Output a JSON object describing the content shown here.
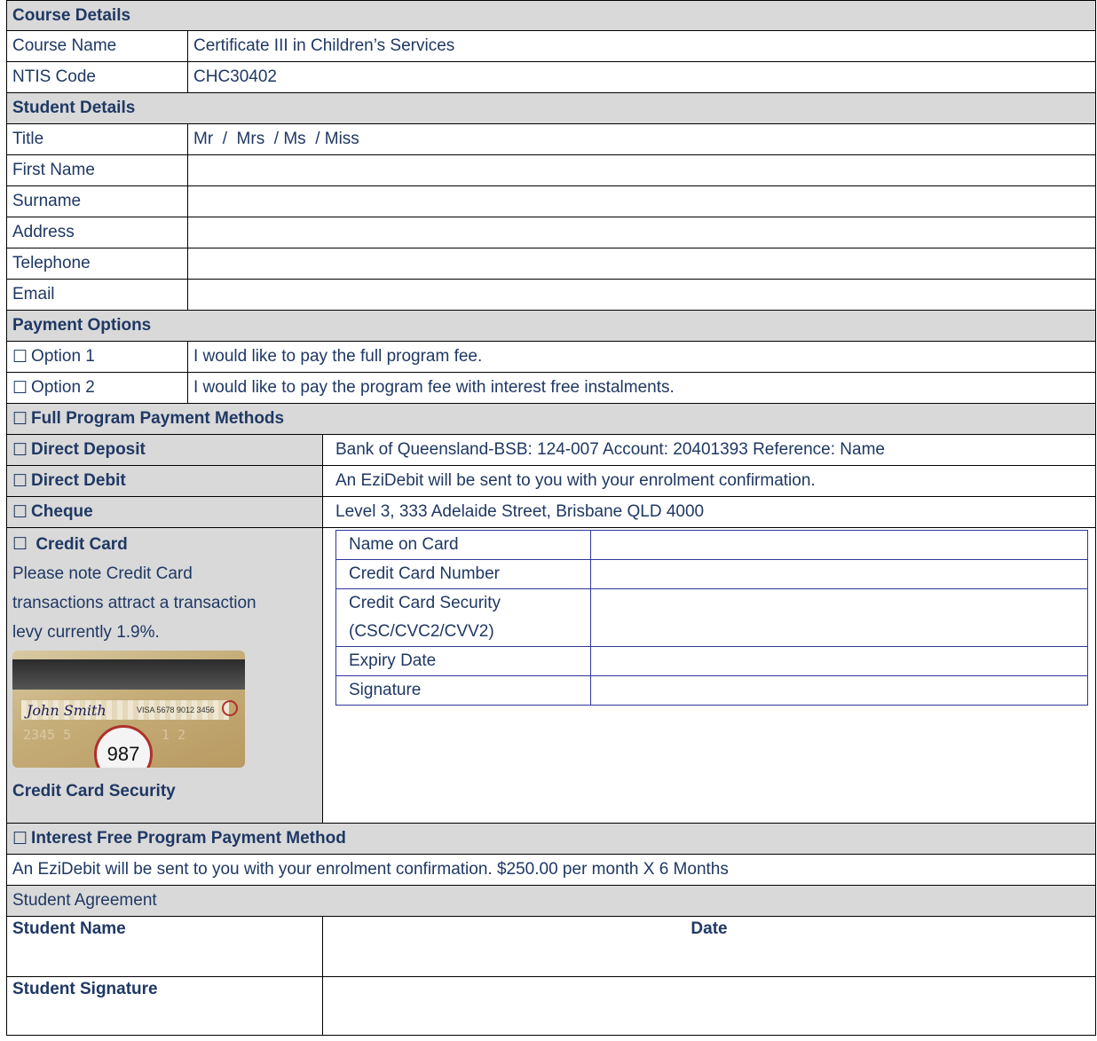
{
  "course": {
    "header": "Course Details",
    "rows": [
      {
        "label": "Course Name",
        "value": "Certificate III in Children’s Services"
      },
      {
        "label": "NTIS Code",
        "value": "CHC30402"
      }
    ]
  },
  "student": {
    "header": "Student Details",
    "rows": [
      {
        "label": "Title",
        "value": "Mr  /  Mrs  / Ms  / Miss"
      },
      {
        "label": "First Name",
        "value": ""
      },
      {
        "label": "Surname",
        "value": ""
      },
      {
        "label": "Address",
        "value": ""
      },
      {
        "label": "Telephone",
        "value": ""
      },
      {
        "label": "Email",
        "value": ""
      }
    ]
  },
  "payment": {
    "header": "Payment Options",
    "checkbox": "☐",
    "options": [
      {
        "label": "Option 1",
        "value": "I would like to pay the full program fee."
      },
      {
        "label": "Option 2",
        "value": "I would like to pay the program fee with interest free instalments."
      }
    ]
  },
  "full_methods": {
    "header": "Full Program Payment Methods",
    "rows": [
      {
        "label": "Direct Deposit",
        "value": "Bank of Queensland-BSB: 124-007 Account: 20401393 Reference: Name"
      },
      {
        "label": "Direct Debit",
        "value": "An EziDebit will be sent to you with your enrolment confirmation."
      },
      {
        "label": "Cheque",
        "value": "Level 3, 333 Adelaide Street, Brisbane QLD 4000"
      }
    ]
  },
  "credit_card": {
    "label": "Credit Card",
    "note_lines": [
      "Please note Credit Card",
      "transactions attract a transaction",
      "levy currently 1.9%."
    ],
    "caption": "Credit Card Security",
    "image": {
      "signature": "John Smith",
      "security_code": "987",
      "strip_number": "VISA 5678 9012 3456"
    },
    "fields": [
      {
        "label": "Name on Card",
        "value": ""
      },
      {
        "label": "Credit Card Number",
        "value": ""
      },
      {
        "label_lines": [
          "Credit Card Security",
          "(CSC/CVC2/CVV2)"
        ],
        "value": ""
      },
      {
        "label": "Expiry Date",
        "value": ""
      },
      {
        "label": "Signature",
        "value": ""
      }
    ]
  },
  "interest_free": {
    "header": "Interest Free Program Payment Method",
    "text": "An EziDebit will be sent to you with your enrolment confirmation. $250.00 per month X 6 Months"
  },
  "agreement": {
    "header": "Student Agreement",
    "student_name": "Student Name",
    "date": "Date",
    "student_signature": "Student Signature"
  },
  "colors": {
    "header_bg": "#d9d9d9",
    "text": "#1f3864",
    "card_border": "#2f3699"
  }
}
